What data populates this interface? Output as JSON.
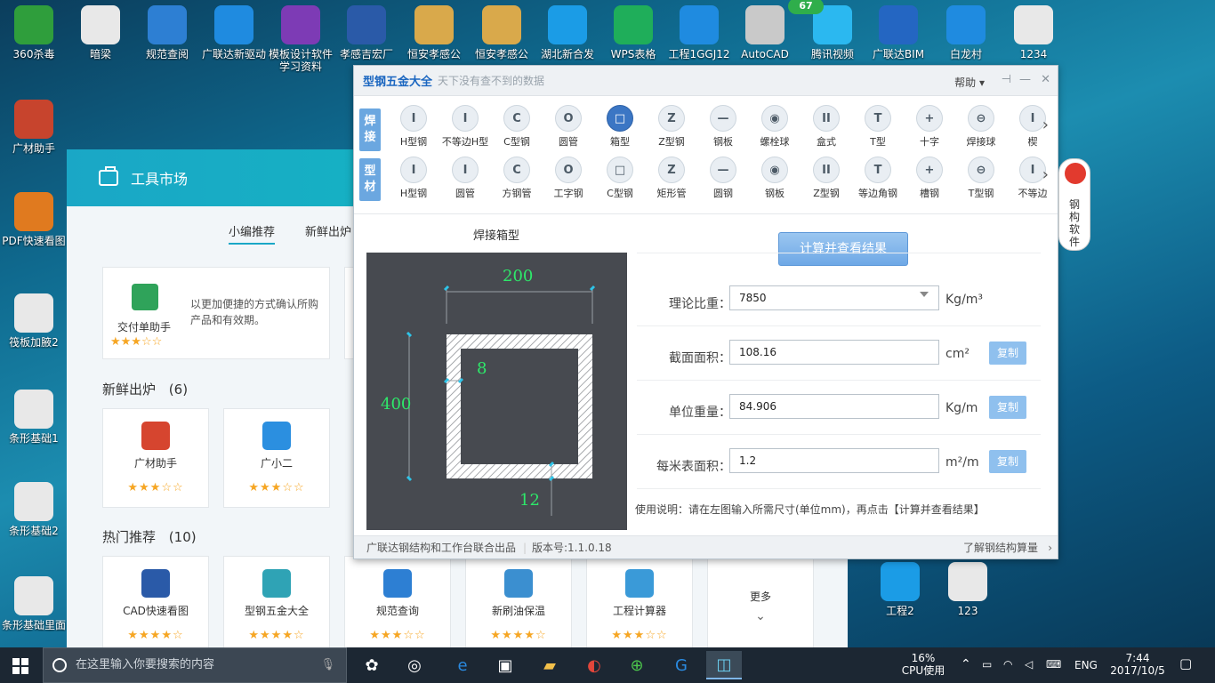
{
  "desktop_icons": [
    {
      "label": "360杀毒",
      "icon": "shield-icon",
      "color": "#2f9e3c"
    },
    {
      "label": "暗梁",
      "icon": "image-icon",
      "color": "#e8e8e8"
    },
    {
      "label": "规范查阅",
      "icon": "book-search-icon",
      "color": "#2d7fd3"
    },
    {
      "label": "广联达新驱动",
      "icon": "glodon-icon",
      "color": "#1f8be0"
    },
    {
      "label": "模板设计软件学习资料",
      "icon": "archive-icon",
      "color": "#7d3bb5"
    },
    {
      "label": "孝感吉宏厂",
      "icon": "cad-icon",
      "color": "#2a5aa8"
    },
    {
      "label": "恒安孝感公",
      "icon": "bid-icon",
      "color": "#d9a94b"
    },
    {
      "label": "恒安孝感公",
      "icon": "list-icon",
      "color": "#d9a94b"
    },
    {
      "label": "湖北新合发",
      "icon": "cross-icon",
      "color": "#1b9ce6"
    },
    {
      "label": "WPS表格",
      "icon": "wps-icon",
      "color": "#1fae5a"
    },
    {
      "label": "工程1GGJ12",
      "icon": "glodon-icon",
      "color": "#1f8be0"
    },
    {
      "label": "AutoCAD",
      "icon": "autocad-icon",
      "color": "#c9c9c9"
    },
    {
      "label": "腾讯视频",
      "icon": "video-icon",
      "color": "#2bb8f0"
    },
    {
      "label": "广联达BIM",
      "icon": "bim-icon",
      "color": "#2466c2"
    },
    {
      "label": "白龙村",
      "icon": "glodon-icon",
      "color": "#1f8be0"
    },
    {
      "label": "1234",
      "icon": "image-icon",
      "color": "#e8e8e8"
    }
  ],
  "desktop_left_icons": [
    {
      "label": "广材助手",
      "icon": "bricks-icon",
      "color": "#c7442d"
    },
    {
      "label": "PDF快速看图",
      "icon": "pdf-icon",
      "color": "#e07a1f"
    },
    {
      "label": "筏板加腋2",
      "icon": "image-icon",
      "color": "#e8e8e8"
    },
    {
      "label": "条形基础1",
      "icon": "image-icon",
      "color": "#e8e8e8"
    },
    {
      "label": "条形基础2",
      "icon": "image-icon",
      "color": "#e8e8e8"
    },
    {
      "label": "条形基础里面",
      "icon": "image-icon",
      "color": "#e8e8e8"
    }
  ],
  "desktop_right_icons": [
    {
      "label": "工程2",
      "icon": "cross-icon",
      "color": "#1b9ce6"
    },
    {
      "label": "123",
      "icon": "image-icon",
      "color": "#e8e8e8"
    }
  ],
  "badge_count": "67",
  "market": {
    "title": "工具市场",
    "tabs": [
      "小编推荐",
      "新鲜出炉"
    ],
    "featured": {
      "name": "交付单助手",
      "desc": "以更加便捷的方式确认所购产品和有效期。",
      "stars": "★★★☆☆"
    },
    "new_section": {
      "title": "新鲜出炉",
      "count": "(6)"
    },
    "new_items": [
      {
        "name": "广材助手",
        "stars": "★★★☆☆"
      },
      {
        "name": "广小二",
        "stars": "★★★☆☆"
      }
    ],
    "hot_section": {
      "title": "热门推荐",
      "count": "(10)"
    },
    "hot_items": [
      {
        "name": "CAD快速看图",
        "stars": "★★★★☆"
      },
      {
        "name": "型钢五金大全",
        "stars": "★★★★☆"
      },
      {
        "name": "规范查询",
        "stars": "★★★☆☆"
      },
      {
        "name": "新刷油保温",
        "stars": "★★★★☆"
      },
      {
        "name": "工程计算器",
        "stars": "★★★☆☆"
      }
    ],
    "more_label": "更多"
  },
  "steel": {
    "title": "型钢五金大全",
    "subtitle": "天下没有查不到的数据",
    "help_label": "帮助",
    "row1_tag": "焊接",
    "row1_items": [
      "H型钢",
      "不等边H型",
      "C型钢",
      "圆管",
      "箱型",
      "Z型钢",
      "钢板",
      "螺栓球",
      "盒式",
      "T型",
      "十字",
      "焊接球",
      "楔"
    ],
    "row1_selected": 4,
    "row2_tag": "型材",
    "row2_items": [
      "H型钢",
      "圆管",
      "方钢管",
      "工字钢",
      "C型钢",
      "矩形管",
      "圆钢",
      "钢板",
      "Z型钢",
      "等边角钢",
      "槽钢",
      "T型钢",
      "不等边"
    ],
    "drawing_title": "焊接箱型",
    "dims": {
      "width": "200",
      "height": "400",
      "web": "8",
      "flange": "12"
    },
    "calc_button": "计算并查看结果",
    "fields": [
      {
        "label": "理论比重：",
        "value": "7850",
        "unit": "Kg/m³",
        "dropdown": true,
        "copy": ""
      },
      {
        "label": "截面面积：",
        "value": "108.16",
        "unit": "cm²",
        "dropdown": false,
        "copy": "复制"
      },
      {
        "label": "单位重量：",
        "value": "84.906",
        "unit": "Kg/m",
        "dropdown": false,
        "copy": "复制"
      },
      {
        "label": "每米表面积：",
        "value": "1.2",
        "unit": "m²/m",
        "dropdown": false,
        "copy": "复制"
      }
    ],
    "usage": "使用说明：请在左图输入所需尺寸(单位mm)，再点击【计算并查看结果】",
    "footer_left": "广联达钢结构和工作台联合出品",
    "footer_version": "版本号:1.1.0.18",
    "footer_right": "了解钢结构算量"
  },
  "mascot_text": "钢构软件",
  "taskbar": {
    "search_placeholder": "在这里输入你要搜索的内容",
    "cpu_percent": "16%",
    "cpu_label": "CPU使用",
    "lang": "ENG",
    "time": "7:44",
    "date": "2017/10/5"
  }
}
